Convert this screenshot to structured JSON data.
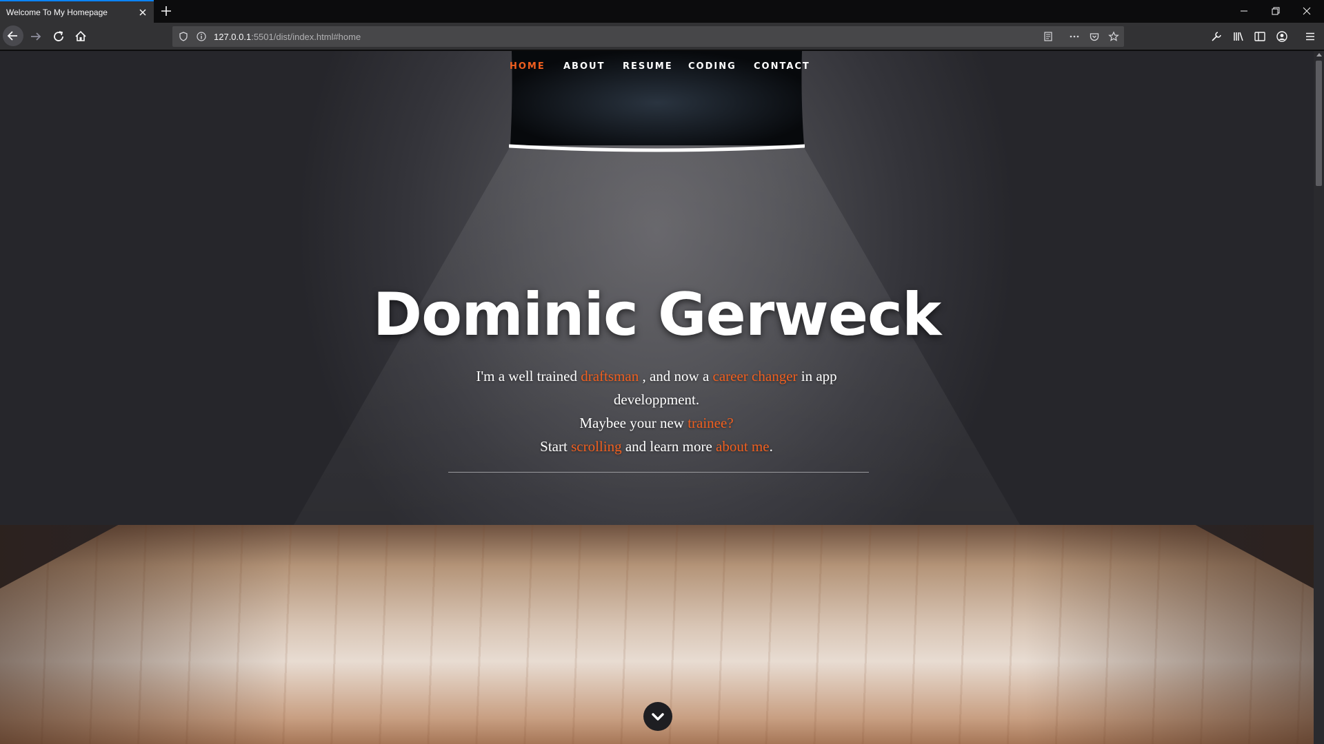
{
  "browser": {
    "tab_title": "Welcome To My Homepage",
    "url_host": "127.0.0.1",
    "url_rest": ":5501/dist/index.html#home"
  },
  "nav": {
    "items": [
      {
        "label": "HOME"
      },
      {
        "label": "ABOUT"
      },
      {
        "label": "RESUME"
      },
      {
        "label": "CODING"
      },
      {
        "label": "CONTACT"
      }
    ]
  },
  "hero": {
    "title": "Dominic Gerweck",
    "line1_a": "I'm a well trained ",
    "line1_hl1": "draftsman",
    "line1_b": " , and now a ",
    "line1_hl2": "career changer",
    "line1_c": " in app developpment.",
    "line2_a": "Maybee your new ",
    "line2_hl": "trainee?",
    "line3_a": "Start ",
    "line3_hl1": "scrolling",
    "line3_b": " and learn more ",
    "line3_hl2": "about me",
    "line3_c": "."
  },
  "colors": {
    "accent": "#f05f1f",
    "browser_accent": "#0a84ff"
  },
  "icons": {
    "scroll": "chevron-down-icon"
  }
}
